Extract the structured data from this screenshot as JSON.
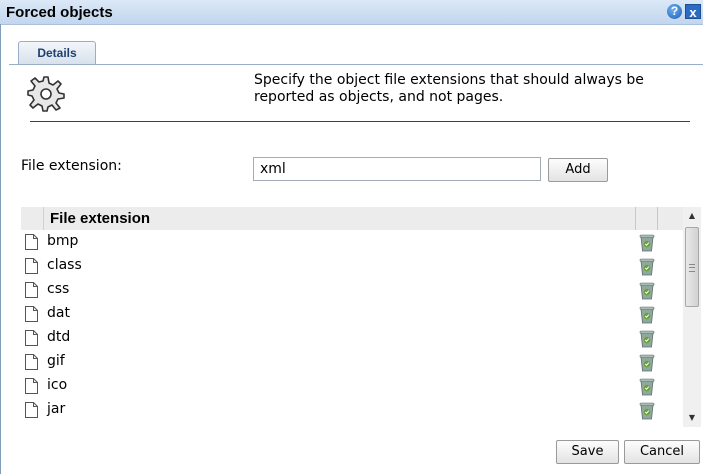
{
  "window": {
    "title": "Forced objects",
    "help_glyph": "?",
    "close_glyph": "x"
  },
  "tabs": [
    {
      "label": "Details"
    }
  ],
  "description": "Specify the object file extensions that should always be\nreported as objects, and not pages.",
  "form": {
    "label": "File extension:",
    "value": "xml",
    "add_label": "Add"
  },
  "grid": {
    "column_header": "File extension",
    "rows": [
      "bmp",
      "class",
      "css",
      "dat",
      "dtd",
      "gif",
      "ico",
      "jar"
    ]
  },
  "footer": {
    "save_label": "Save",
    "cancel_label": "Cancel"
  },
  "icons": {
    "settings": "gear-icon",
    "file": "file-icon",
    "delete": "trash-icon"
  },
  "colors": {
    "titlebar": "#c3d6ee",
    "tab_text": "#1f3f6f",
    "trash_green": "#6a9f3a"
  }
}
